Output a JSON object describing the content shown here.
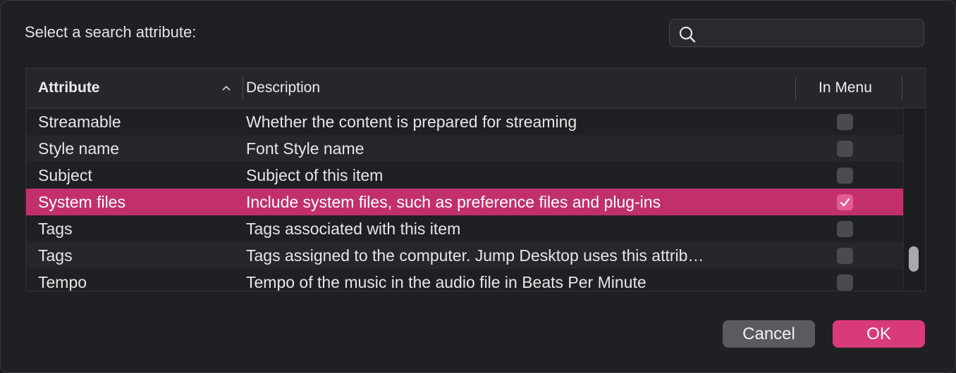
{
  "dialog": {
    "prompt": "Select a search attribute:",
    "search": {
      "value": "",
      "placeholder": "",
      "icon": "search-icon"
    }
  },
  "table": {
    "columns": {
      "attribute": "Attribute",
      "description": "Description",
      "in_menu": "In Menu"
    },
    "sort": {
      "column": "Attribute",
      "direction": "ascending",
      "icon": "chevron-up-icon"
    },
    "rows": [
      {
        "attribute": "Streamable",
        "description": "Whether the content is prepared for streaming",
        "in_menu": false
      },
      {
        "attribute": "Style name",
        "description": "Font Style name",
        "in_menu": false
      },
      {
        "attribute": "Subject",
        "description": "Subject of this item",
        "in_menu": false
      },
      {
        "attribute": "System files",
        "description": "Include system files, such as preference files and plug-ins",
        "in_menu": true,
        "selected": true
      },
      {
        "attribute": "Tags",
        "description": "Tags associated with this item",
        "in_menu": false
      },
      {
        "attribute": "Tags",
        "description": "Tags assigned to the computer. Jump Desktop uses this attrib…",
        "in_menu": false
      },
      {
        "attribute": "Tempo",
        "description": "Tempo of the music in the audio file in Beats Per Minute",
        "in_menu": false
      }
    ]
  },
  "buttons": {
    "cancel": "Cancel",
    "ok": "OK"
  },
  "colors": {
    "accent": "#c2306c",
    "ok_button": "#d93a7a",
    "background": "#1f2024"
  }
}
